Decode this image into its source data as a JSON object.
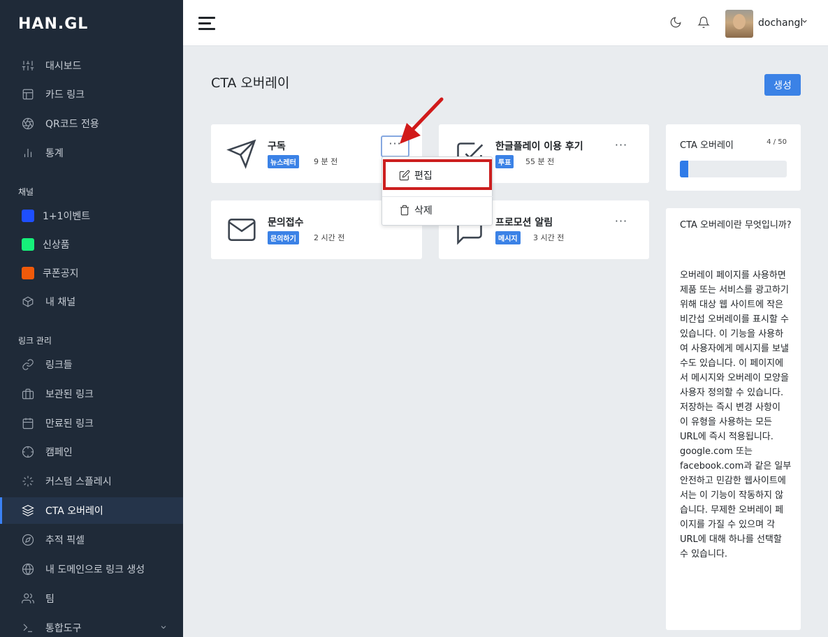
{
  "brand": {
    "logo": "HAN.GL"
  },
  "sidebar": {
    "main": [
      {
        "label": "대시보드",
        "icon": "sliders-icon"
      },
      {
        "label": "카드 링크",
        "icon": "layout-icon"
      },
      {
        "label": "QR코드 전용",
        "icon": "aperture-icon"
      },
      {
        "label": "통계",
        "icon": "bar-chart-icon"
      }
    ],
    "channels_title": "채널",
    "channels": [
      {
        "label": "1+1이벤트",
        "color": "#1e4fff"
      },
      {
        "label": "신상품",
        "color": "#16f07a"
      },
      {
        "label": "쿠폰공지",
        "color": "#f05a0a"
      },
      {
        "label": "내 채널",
        "icon": "box-icon"
      }
    ],
    "links_title": "링크 관리",
    "links": [
      {
        "label": "링크들",
        "icon": "link-icon"
      },
      {
        "label": "보관된 링크",
        "icon": "briefcase-icon"
      },
      {
        "label": "만료된 링크",
        "icon": "calendar-icon"
      },
      {
        "label": "캠페인",
        "icon": "crosshair-icon"
      },
      {
        "label": "커스텀 스플레시",
        "icon": "loader-icon"
      },
      {
        "label": "CTA 오버레이",
        "icon": "layers-icon",
        "active": true
      },
      {
        "label": "추적 픽셀",
        "icon": "compass-icon"
      },
      {
        "label": "내 도메인으로 링크 생성",
        "icon": "globe-icon"
      },
      {
        "label": "팀",
        "icon": "users-icon"
      },
      {
        "label": "통합도구",
        "icon": "terminal-icon"
      }
    ]
  },
  "topbar": {
    "username": "dochangl"
  },
  "page": {
    "title": "CTA 오버레이",
    "create_label": "생성"
  },
  "cards": [
    {
      "title": "구독",
      "badge": "뉴스레터",
      "time": "9 분 전",
      "icon": "send-icon"
    },
    {
      "title": "한글플레이 이용 후기",
      "badge": "투표",
      "time": "55 분 전",
      "icon": "check-square-icon"
    },
    {
      "title": "문의접수",
      "badge": "문의하기",
      "time": "2 시간 전",
      "icon": "mail-icon"
    },
    {
      "title": "프로모션 알림",
      "badge": "메시지",
      "time": "3 시간 전",
      "icon": "message-square-icon"
    }
  ],
  "dropdown": {
    "edit_label": "편집",
    "delete_label": "삭제"
  },
  "stats": {
    "title": "CTA 오버레이",
    "count": "4 / 50",
    "used": 4,
    "max": 50
  },
  "info": {
    "question": "CTA 오버레이란 무엇입니까?",
    "answer": "오버레이 페이지를 사용하면 제품 또는 서비스를 광고하기 위해 대상 웹 사이트에 작은 비간섭 오버레이를 표시할 수 있습니다. 이 기능을 사용하여 사용자에게 메시지를 보낼 수도 있습니다. 이 페이지에서 메시지와 오버레이 모양을 사용자 정의할 수 있습니다. 저장하는 즉시 변경 사항이 이 유형을 사용하는 모든 URL에 즉시 적용됩니다. google.com 또는 facebook.com과 같은 일부 안전하고 민감한 웹사이트에서는 이 기능이 작동하지 않습니다. 무제한 오버레이 페이지를 가질 수 있으며 각 URL에 대해 하나를 선택할 수 있습니다."
  },
  "colors": {
    "sidebar_bg": "#1f2a38",
    "accent": "#3b82e6",
    "highlight": "#cc1f1f"
  }
}
